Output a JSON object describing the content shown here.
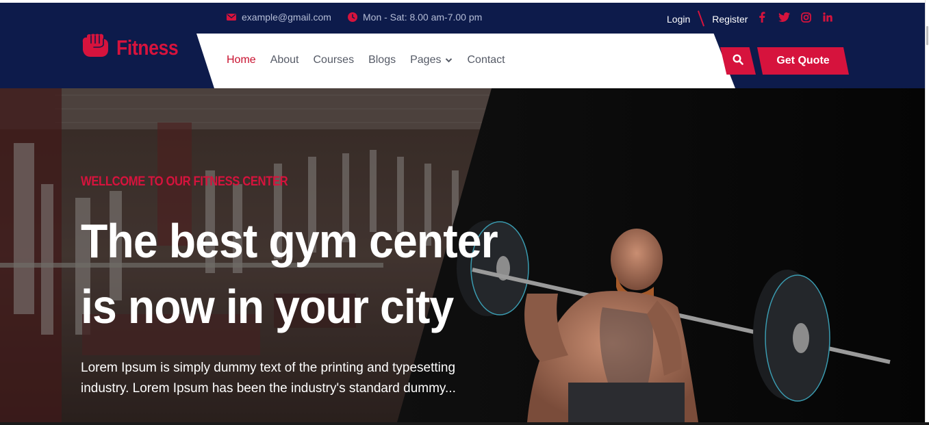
{
  "topbar": {
    "email": "example@gmail.com",
    "email_icon": "envelope-icon",
    "hours": "Mon - Sat: 8.00 am-7.00 pm",
    "hours_icon": "clock-icon",
    "login": "Login",
    "register": "Register",
    "socials": [
      "facebook-icon",
      "twitter-icon",
      "instagram-icon",
      "linkedin-icon"
    ]
  },
  "brand": {
    "name": "Fitness",
    "icon": "fist-icon"
  },
  "nav": {
    "items": [
      {
        "label": "Home",
        "active": true
      },
      {
        "label": "About"
      },
      {
        "label": "Courses"
      },
      {
        "label": "Blogs"
      },
      {
        "label": "Pages",
        "dropdown": true
      },
      {
        "label": "Contact"
      }
    ],
    "search_icon": "search-icon",
    "cta": "Get Quote"
  },
  "hero": {
    "eyebrow": "WELLCOME TO OUR FITNESS CENTER",
    "headline_line1": "The best gym center",
    "headline_line2": "is now in your city",
    "description_line1": "Lorem Ipsum is simply dummy text of the printing and typesetting",
    "description_line2": "industry. Lorem Ipsum has been the industry's standard dummy..."
  },
  "colors": {
    "navy": "#0d1b4b",
    "accent": "#d6133d",
    "white": "#ffffff"
  }
}
